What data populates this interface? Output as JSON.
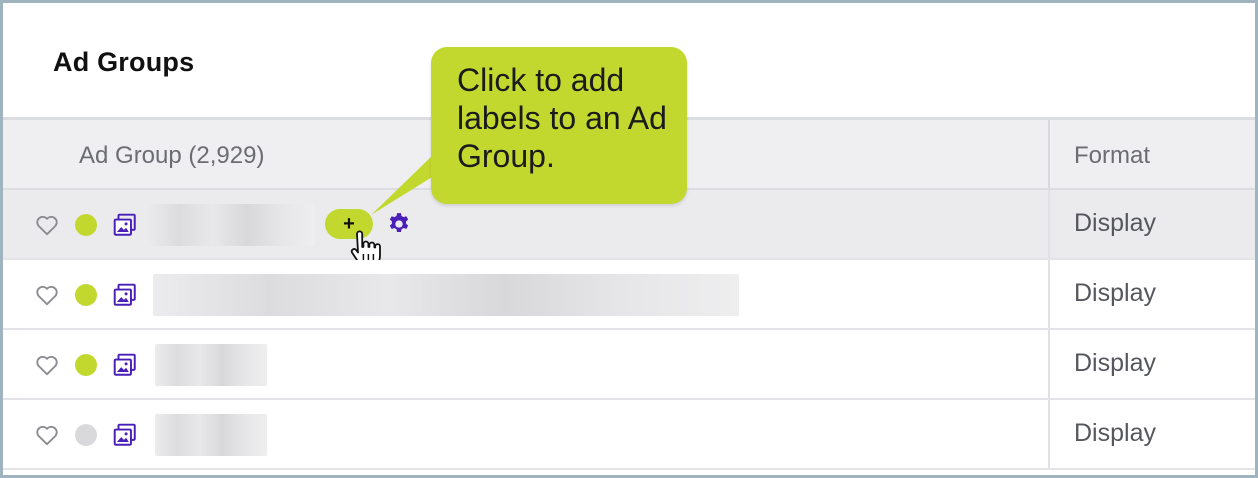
{
  "panel": {
    "title": "Ad Groups"
  },
  "table": {
    "columns": {
      "ad_group": "Ad Group (2,929)",
      "format": "Format"
    },
    "rows": [
      {
        "status": "active",
        "format": "Display"
      },
      {
        "status": "active",
        "format": "Display"
      },
      {
        "status": "active",
        "format": "Display"
      },
      {
        "status": "inactive",
        "format": "Display"
      }
    ],
    "row_actions": {
      "add_label": "+"
    }
  },
  "callout": {
    "text": "Click to add labels to an Ad Group."
  },
  "colors": {
    "accent_lime": "#c3d82f",
    "active_status": "#c3d82f",
    "inactive_status": "#d9d9db",
    "icon_purple": "#4a1fb8",
    "frame_border": "#9fb4bf"
  },
  "icons": [
    "heart-icon",
    "status-dot",
    "image-icon",
    "gear-icon",
    "hand-cursor-icon"
  ]
}
